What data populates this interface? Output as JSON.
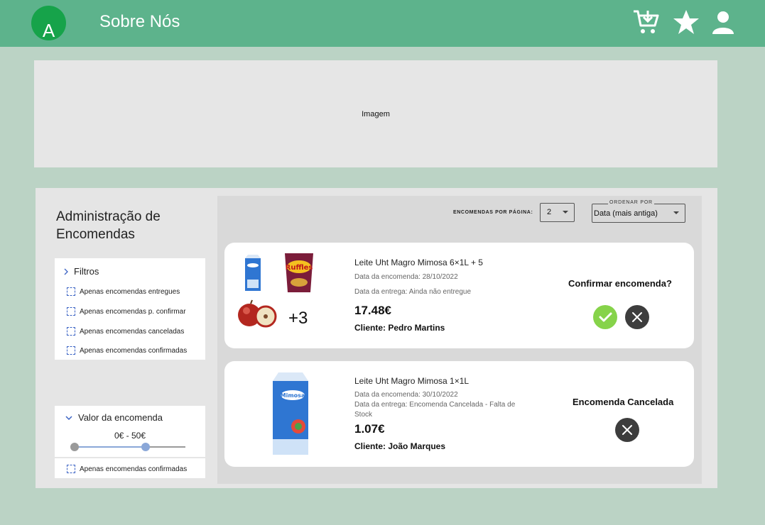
{
  "header": {
    "logo_letter": "A",
    "nav_about": "Sobre Nós",
    "icons": [
      "add-to-cart-icon",
      "star-icon",
      "user-icon"
    ]
  },
  "hero": {
    "label": "Imagem"
  },
  "sidebar": {
    "title": "Administração de Encomendas",
    "filters_title": "Filtros",
    "filters": [
      "Apenas encomendas entregues",
      "Apenas encomendas p. confirmar",
      "Apenas encomendas canceladas",
      "Apenas encomendas confirmadas"
    ],
    "value_title": "Valor da encomenda",
    "value_range": "0€ - 50€",
    "extra_filter": "Apenas encomendas confirmadas"
  },
  "toolbar": {
    "per_page_label": "ENCOMENDAS POR PÁGINA:",
    "per_page_value": "2",
    "order_label": "ORDENAR POR",
    "order_value": "Data (mais antiga)"
  },
  "orders": [
    {
      "product": "Leite Uht Magro Mimosa 6×1L + 5",
      "order_date": "Data da encomenda: 28/10/2022",
      "delivery": "Data da entrega: Ainda não entregue",
      "price": "17.48€",
      "client": "Cliente: Pedro Martins",
      "status": "Confirmar encomenda?",
      "more_items": "+3"
    },
    {
      "product": "Leite Uht Magro Mimosa 1×1L",
      "order_date": "Data da encomenda: 30/10/2022",
      "delivery": "Data da entrega: Encomenda Cancelada - Falta de Stock",
      "price": "1.07€",
      "client": "Cliente: João Marques",
      "status": "Encomenda Cancelada"
    }
  ],
  "colors": {
    "header": "#5db38c",
    "background": "#bbd3c5",
    "confirm": "#86d34a",
    "cancel": "#3d3d3d"
  }
}
